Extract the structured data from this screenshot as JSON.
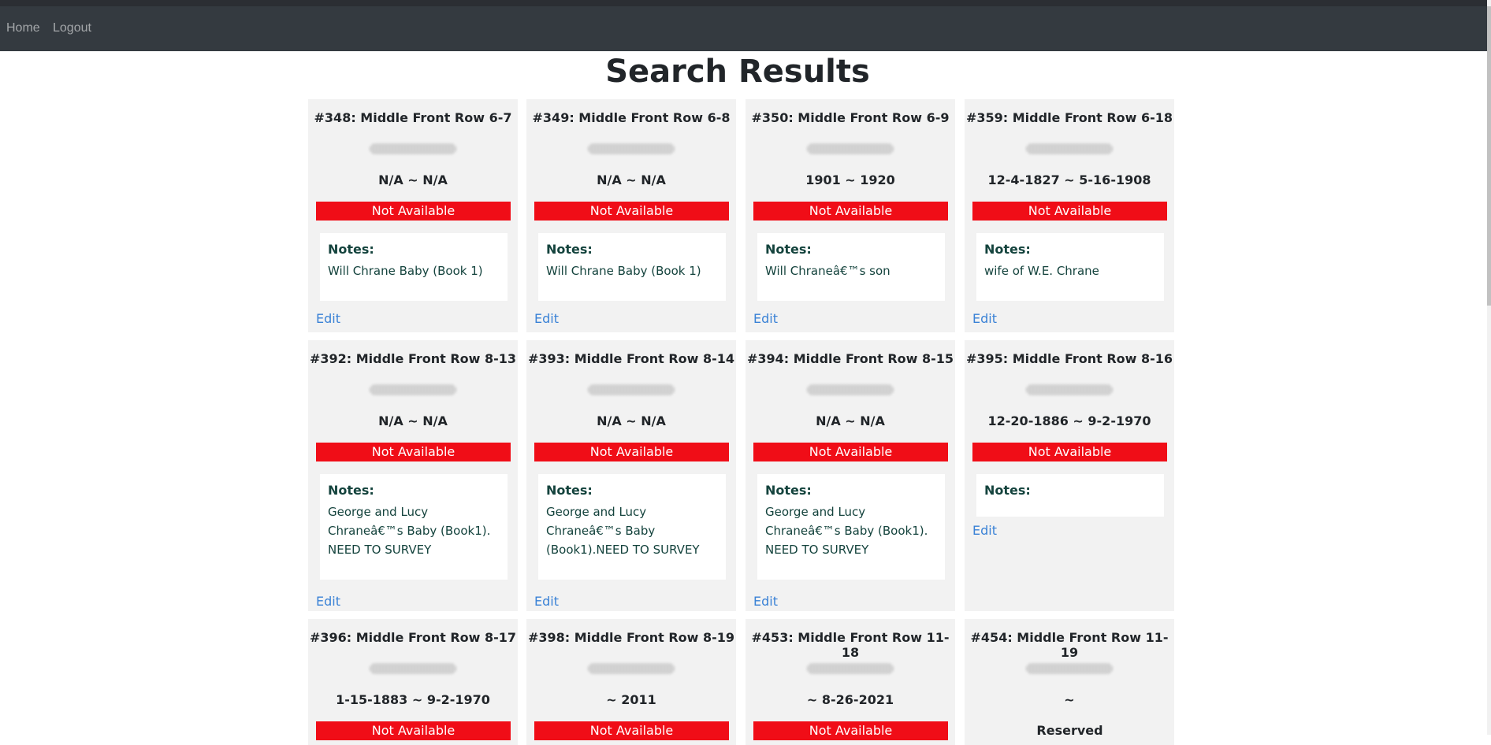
{
  "nav": {
    "home": "Home",
    "logout": "Logout"
  },
  "page": {
    "title": "Search Results"
  },
  "labels": {
    "notes": "Notes:",
    "edit": "Edit"
  },
  "cards": [
    {
      "title": "#348: Middle Front Row 6-7",
      "dates": "N/A ~ N/A",
      "status": "Not Available",
      "note": "Will Chrane Baby (Book 1)"
    },
    {
      "title": "#349: Middle Front Row 6-8",
      "dates": "N/A ~ N/A",
      "status": "Not Available",
      "note": "Will Chrane Baby (Book 1)"
    },
    {
      "title": "#350: Middle Front Row 6-9",
      "dates": "1901 ~ 1920",
      "status": "Not Available",
      "note": "Will Chraneâ€™s son"
    },
    {
      "title": "#359: Middle Front Row 6-18",
      "dates": "12-4-1827 ~ 5-16-1908",
      "status": "Not Available",
      "note": "wife of W.E. Chrane"
    },
    {
      "title": "#392: Middle Front Row 8-13",
      "dates": "N/A ~ N/A",
      "status": "Not Available",
      "note": "George and Lucy Chraneâ€™s Baby (Book1). NEED TO SURVEY"
    },
    {
      "title": "#393: Middle Front Row 8-14",
      "dates": "N/A ~ N/A",
      "status": "Not Available",
      "note": "George and Lucy Chraneâ€™s Baby (Book1).NEED TO SURVEY"
    },
    {
      "title": "#394: Middle Front Row 8-15",
      "dates": "N/A ~ N/A",
      "status": "Not Available",
      "note": "George and Lucy Chraneâ€™s Baby (Book1). NEED TO SURVEY"
    },
    {
      "title": "#395: Middle Front Row 8-16",
      "dates": "12-20-1886 ~ 9-2-1970",
      "status": "Not Available",
      "note": ""
    },
    {
      "title": "#396: Middle Front Row 8-17",
      "dates": "1-15-1883 ~ 9-2-1970",
      "status": "Not Available",
      "note": ""
    },
    {
      "title": "#398: Middle Front Row 8-19",
      "dates": "~ 2011",
      "status": "Not Available",
      "note": ""
    },
    {
      "title": "#453: Middle Front Row 11-18",
      "dates": "~ 8-26-2021",
      "status": "Not Available",
      "note": ""
    },
    {
      "title": "#454: Middle Front Row 11-19",
      "dates": "~",
      "status": "Reserved",
      "note": ""
    }
  ]
}
